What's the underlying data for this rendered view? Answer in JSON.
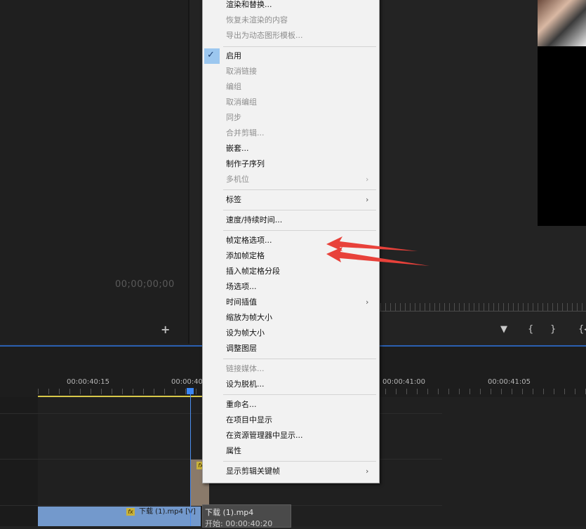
{
  "source_monitor": {
    "timecode": "00;00;00;00",
    "add_icon": "+"
  },
  "program_monitor": {
    "controls": [
      "▼",
      "{",
      "}",
      "{◀"
    ]
  },
  "timeline": {
    "time_labels": [
      "00:00:40:15",
      "00:00:40:",
      "00:00:41:00",
      "00:00:41:05"
    ],
    "clip_label": "下载 (1).mp4 [V]",
    "fx_label": "fx",
    "tooltip": {
      "title": "下载 (1).mp4",
      "subtitle": "开始: 00:00:40:20"
    }
  },
  "context_menu": {
    "items": [
      {
        "label": "渲染和替换...",
        "enabled": true
      },
      {
        "label": "恢复未渲染的内容",
        "enabled": false
      },
      {
        "label": "导出为动态图形模板...",
        "enabled": false
      },
      {
        "label": "启用",
        "enabled": true,
        "checked": true
      },
      {
        "label": "取消链接",
        "enabled": false
      },
      {
        "label": "编组",
        "enabled": false
      },
      {
        "label": "取消编组",
        "enabled": false
      },
      {
        "label": "同步",
        "enabled": false
      },
      {
        "label": "合并剪辑...",
        "enabled": false
      },
      {
        "label": "嵌套...",
        "enabled": true
      },
      {
        "label": "制作子序列",
        "enabled": true
      },
      {
        "label": "多机位",
        "enabled": false,
        "submenu": true
      },
      {
        "label": "标签",
        "enabled": true,
        "submenu": true
      },
      {
        "label": "速度/持续时间...",
        "enabled": true
      },
      {
        "label": "帧定格选项...",
        "enabled": true
      },
      {
        "label": "添加帧定格",
        "enabled": true
      },
      {
        "label": "插入帧定格分段",
        "enabled": true
      },
      {
        "label": "场选项...",
        "enabled": true
      },
      {
        "label": "时间插值",
        "enabled": true,
        "submenu": true
      },
      {
        "label": "缩放为帧大小",
        "enabled": true
      },
      {
        "label": "设为帧大小",
        "enabled": true
      },
      {
        "label": "调整图层",
        "enabled": true
      },
      {
        "label": "链接媒体...",
        "enabled": false
      },
      {
        "label": "设为脱机...",
        "enabled": true
      },
      {
        "label": "重命名...",
        "enabled": true
      },
      {
        "label": "在项目中显示",
        "enabled": true
      },
      {
        "label": "在资源管理器中显示...",
        "enabled": true
      },
      {
        "label": "属性",
        "enabled": true
      },
      {
        "label": "显示剪辑关键帧",
        "enabled": true,
        "submenu": true
      }
    ],
    "checkmark_icon": "checkmark-icon",
    "submenu_icon": "chevron-right-icon"
  },
  "colors": {
    "annotation_arrow": "#e8413a",
    "playhead": "#3a86f5",
    "clip": "#7399cc",
    "check_highlight": "#9cc7ef"
  }
}
